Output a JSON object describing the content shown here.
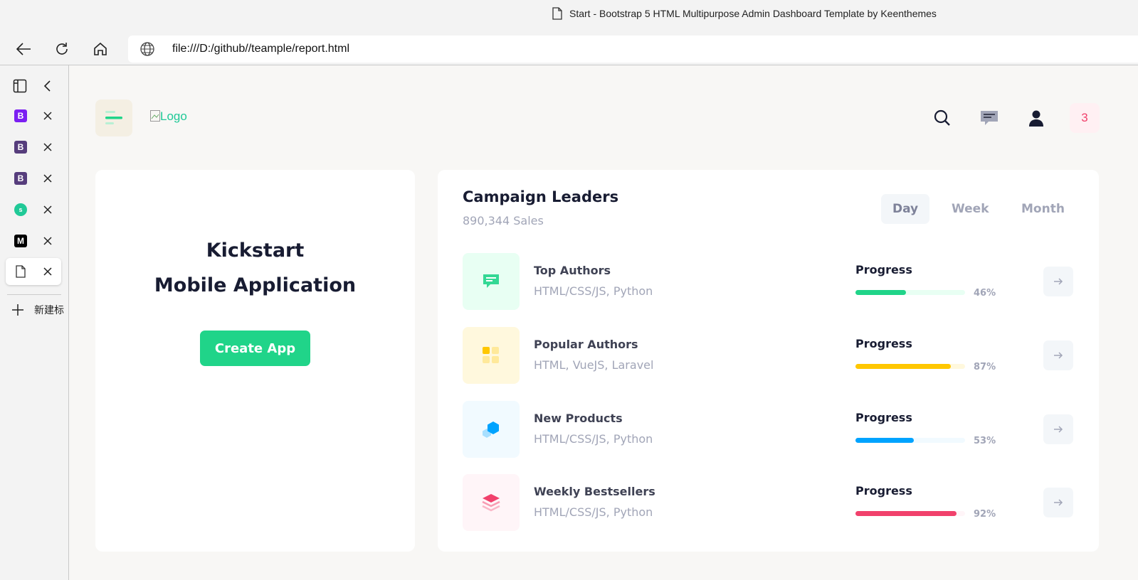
{
  "browser": {
    "window_title": "Start - Bootstrap 5 HTML Multipurpose Admin Dashboard Template by Keenthemes",
    "url": "file:///D:/github//teample/report.html",
    "tabs": [
      {
        "favicon": "B",
        "color": "#7b1ff2"
      },
      {
        "favicon": "B",
        "color": "#563d7c"
      },
      {
        "favicon": "B",
        "color": "#563d7c"
      },
      {
        "favicon": "s",
        "color": "#20c997"
      },
      {
        "favicon": "M",
        "color": "#000000"
      },
      {
        "favicon": "page-icon",
        "color": ""
      }
    ],
    "new_tab_label": "新建标"
  },
  "header": {
    "logo_alt": "Logo",
    "notification_count": "3",
    "icons": [
      "search-icon",
      "chat-icon",
      "user-icon"
    ]
  },
  "kickstart": {
    "line1": "Kickstart",
    "line2": "Mobile Application",
    "button_label": "Create App"
  },
  "campaign": {
    "title": "Campaign Leaders",
    "subtitle": "890,344 Sales",
    "periods": [
      "Day",
      "Week",
      "Month"
    ],
    "active_period": "Day",
    "rows": [
      {
        "name": "Top Authors",
        "sub": "HTML/CSS/JS, Python",
        "label": "Progress",
        "progress": 46,
        "pct": "46%",
        "color": "#20d489",
        "bg": "#e8fff3",
        "icon": "chat-icon"
      },
      {
        "name": "Popular Authors",
        "sub": "HTML, VueJS, Laravel",
        "label": "Progress",
        "progress": 87,
        "pct": "87%",
        "color": "#ffc700",
        "bg": "#fff8dd",
        "icon": "grid-icon"
      },
      {
        "name": "New Products",
        "sub": "HTML/CSS/JS, Python",
        "label": "Progress",
        "progress": 53,
        "pct": "53%",
        "color": "#00a3ff",
        "bg": "#f1faff",
        "icon": "cube-icon"
      },
      {
        "name": "Weekly Bestsellers",
        "sub": "HTML/CSS/JS, Python",
        "label": "Progress",
        "progress": 92,
        "pct": "92%",
        "color": "#f1416c",
        "bg": "#fff5f8",
        "icon": "layers-icon"
      }
    ]
  }
}
